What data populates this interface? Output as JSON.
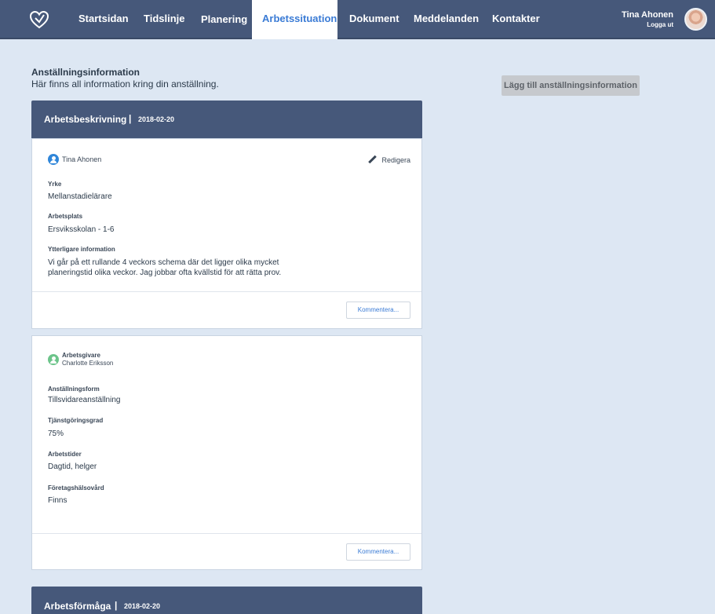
{
  "nav": {
    "items": [
      {
        "label": "Startsidan"
      },
      {
        "label": "Tidslinje"
      },
      {
        "label": "Planering"
      },
      {
        "label": "Arbetssituation"
      },
      {
        "label": "Dokument"
      },
      {
        "label": "Meddelanden"
      },
      {
        "label": "Kontakter"
      }
    ],
    "active_index": 3,
    "user_name": "Tina Ahonen",
    "logout_label": "Logga ut"
  },
  "page": {
    "title": "Anställningsinformation",
    "subtitle": "Här finns all information kring din anställning.",
    "add_button_label": "Lägg till anställningsinformation"
  },
  "card1": {
    "header_title": "Arbetsbeskrivning",
    "header_separator": "|",
    "header_date": "2018-02-20",
    "author": "Tina Ahonen",
    "edit_label": "Redigera",
    "fields": [
      {
        "label": "Yrke",
        "value": "Mellanstadielärare"
      },
      {
        "label": "Arbetsplats",
        "value": "Ersviksskolan - 1-6"
      },
      {
        "label": "Ytterligare information",
        "value_lines": [
          "Vi går på ett rullande 4 veckors schema där det ligger olika mycket",
          "planeringstid olika veckor. Jag jobbar ofta kvällstid för att rätta prov."
        ]
      }
    ],
    "comment_label": "Kommentera..."
  },
  "card2": {
    "role": "Arbetsgivare",
    "author": "Charlotte Eriksson",
    "fields": [
      {
        "label": "Anställningsform",
        "value": "Tillsvidareanställning"
      },
      {
        "label": "Tjänstgöringsgrad",
        "value": "75%"
      },
      {
        "label": "Arbetstider",
        "value": "Dagtid, helger"
      },
      {
        "label": "Företagshälsovård",
        "value": "Finns"
      }
    ],
    "comment_label": "Kommentera..."
  },
  "card3": {
    "header_title": "Arbetsförmåga",
    "header_separator": "|",
    "header_date": "2018-02-20"
  },
  "colors": {
    "nav_bg": "#46587a",
    "page_bg": "#dde7f3",
    "accent": "#3a7bd5",
    "author_icon": "#2f86d9",
    "employer_icon": "#6cc48a"
  },
  "icons": {
    "logo": "heart-logo-icon",
    "author": "person-circle-icon",
    "edit": "pencil-icon"
  }
}
